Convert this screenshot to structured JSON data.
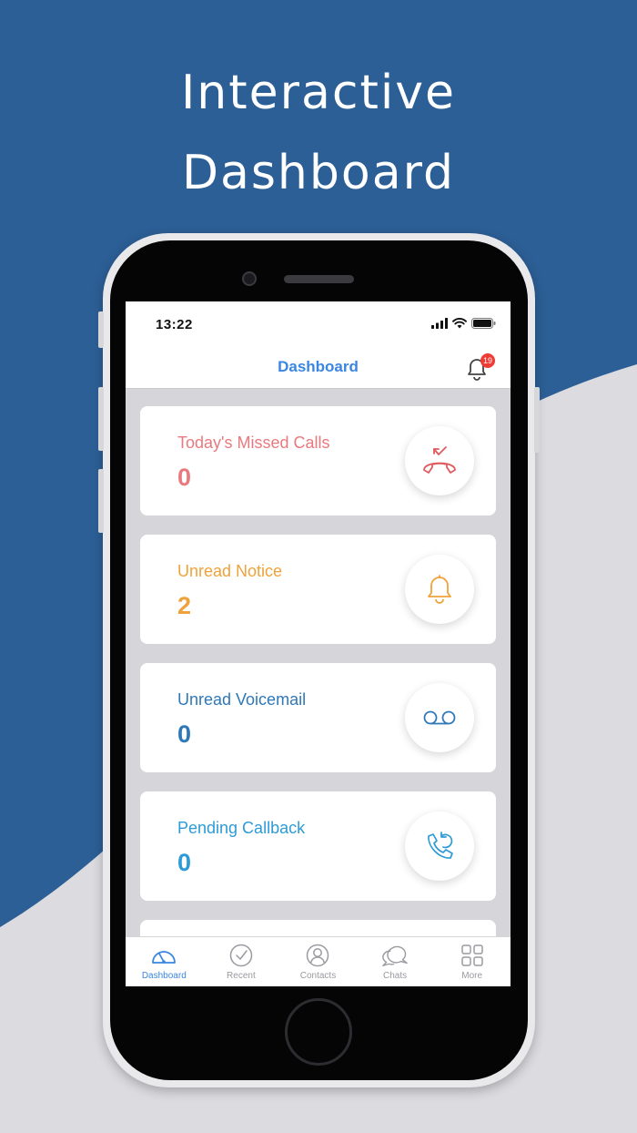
{
  "promo": {
    "headline_line1": "Interactive",
    "headline_line2": "Dashboard"
  },
  "colors": {
    "background_blue": "#2c5f96",
    "background_grey": "#dcdce0",
    "accent_blue": "#3a86e0",
    "missed_calls": "#e87a7f",
    "notice": "#f0a23a",
    "voicemail": "#2e78b8",
    "callback": "#2d9bd6",
    "badge": "#ee3b36"
  },
  "status_bar": {
    "time": "13:22"
  },
  "header": {
    "title": "Dashboard",
    "notification_count": "19",
    "notification_icon": "bell-icon"
  },
  "cards": [
    {
      "label": "Today's Missed Calls",
      "value": "0",
      "icon": "missed-call-icon"
    },
    {
      "label": "Unread Notice",
      "value": "2",
      "icon": "bell-icon"
    },
    {
      "label": "Unread Voicemail",
      "value": "0",
      "icon": "voicemail-icon"
    },
    {
      "label": "Pending Callback",
      "value": "0",
      "icon": "callback-icon"
    }
  ],
  "tabs": [
    {
      "label": "Dashboard",
      "icon": "speedometer-icon",
      "active": true
    },
    {
      "label": "Recent",
      "icon": "clock-icon",
      "active": false
    },
    {
      "label": "Contacts",
      "icon": "contact-icon",
      "active": false
    },
    {
      "label": "Chats",
      "icon": "chat-icon",
      "active": false
    },
    {
      "label": "More",
      "icon": "grid-icon",
      "active": false
    }
  ]
}
